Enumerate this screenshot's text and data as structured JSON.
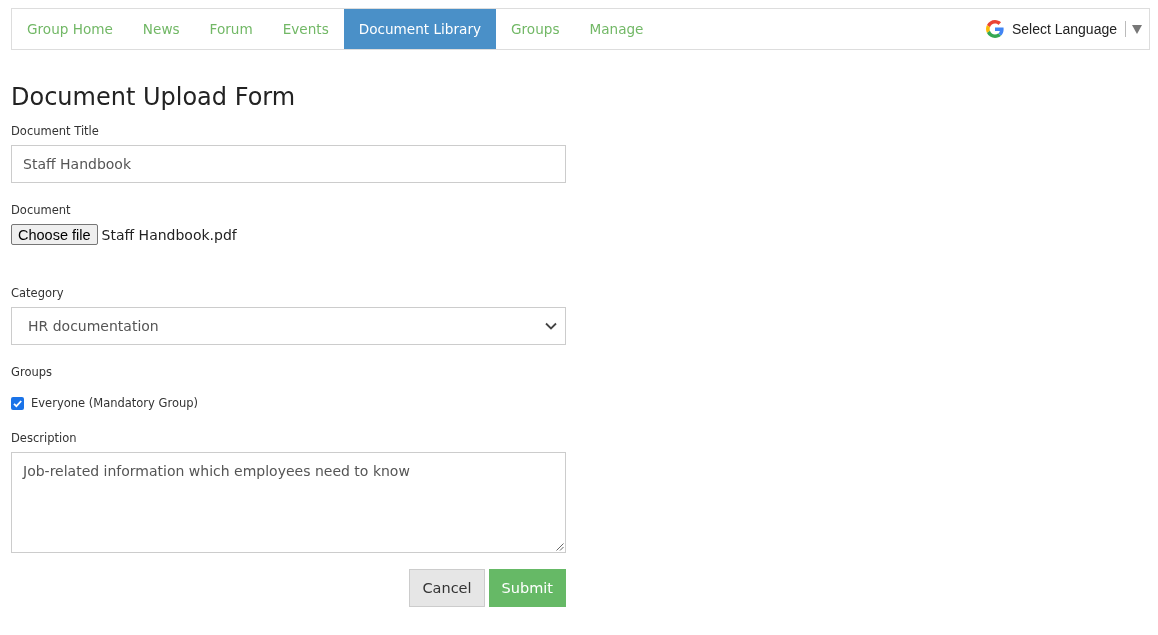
{
  "nav": {
    "tabs": [
      {
        "label": "Group Home",
        "selected": false
      },
      {
        "label": "News",
        "selected": false
      },
      {
        "label": "Forum",
        "selected": false
      },
      {
        "label": "Events",
        "selected": false
      },
      {
        "label": "Document Library",
        "selected": true
      },
      {
        "label": "Groups",
        "selected": false
      },
      {
        "label": "Manage",
        "selected": false
      }
    ],
    "language_selector": {
      "label": "Select Language"
    }
  },
  "form": {
    "title": "Document Upload Form",
    "fields": [
      {
        "kind": "text",
        "label": "Document Title",
        "value": "Staff Handbook"
      },
      {
        "kind": "file",
        "label": "Document",
        "button": "Choose file",
        "file_name": "Staff Handbook.pdf"
      },
      {
        "kind": "select",
        "label": "Category",
        "value": "HR documentation"
      },
      {
        "kind": "checkboxes",
        "label": "Groups",
        "options": [
          {
            "label": "Everyone (Mandatory Group)",
            "checked": true
          }
        ]
      },
      {
        "kind": "textarea",
        "label": "Description",
        "value": "Job-related information which employees need to know"
      }
    ],
    "buttons": [
      {
        "kind": "secondary",
        "label": "Cancel"
      },
      {
        "kind": "primary",
        "label": "Submit"
      }
    ]
  }
}
